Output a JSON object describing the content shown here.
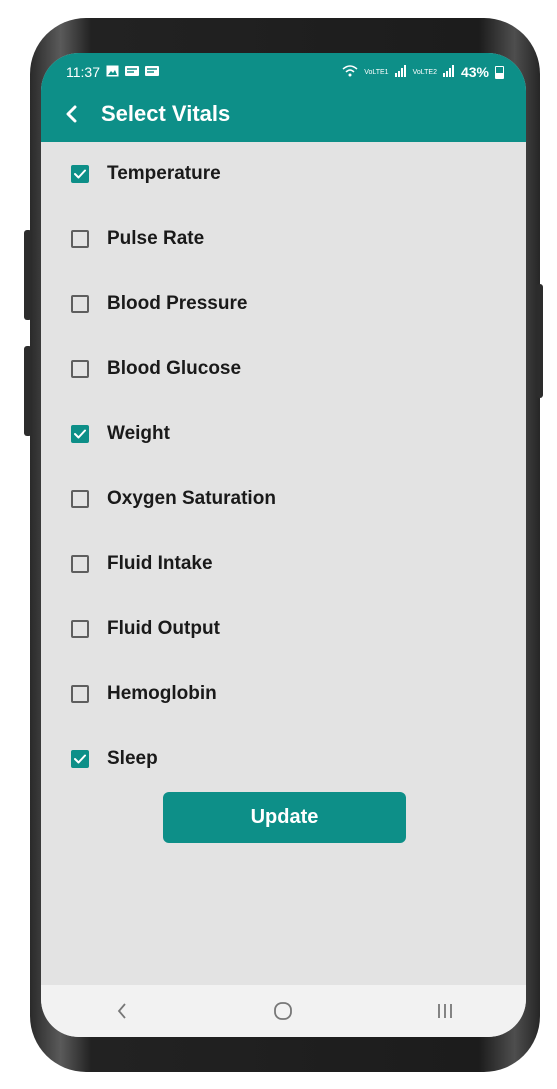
{
  "status": {
    "time": "11:37",
    "left_icons": [
      "image-icon",
      "notification-icon",
      "notification-icon"
    ],
    "network1": "VoLTE1",
    "network2": "VoLTE2",
    "battery": "43%"
  },
  "header": {
    "title": "Select Vitals",
    "back_icon": "chevron-left-icon",
    "color": "#0d8f88"
  },
  "vitals": [
    {
      "label": "Temperature",
      "checked": true
    },
    {
      "label": "Pulse Rate",
      "checked": false
    },
    {
      "label": "Blood Pressure",
      "checked": false
    },
    {
      "label": "Blood Glucose",
      "checked": false
    },
    {
      "label": "Weight",
      "checked": true
    },
    {
      "label": "Oxygen Saturation",
      "checked": false
    },
    {
      "label": "Fluid Intake",
      "checked": false
    },
    {
      "label": "Fluid Output",
      "checked": false
    },
    {
      "label": "Hemoglobin",
      "checked": false
    },
    {
      "label": "Sleep",
      "checked": true
    }
  ],
  "update_button": {
    "label": "Update"
  },
  "navbar": {
    "back": "back-icon",
    "home": "home-icon",
    "recents": "recents-icon"
  }
}
